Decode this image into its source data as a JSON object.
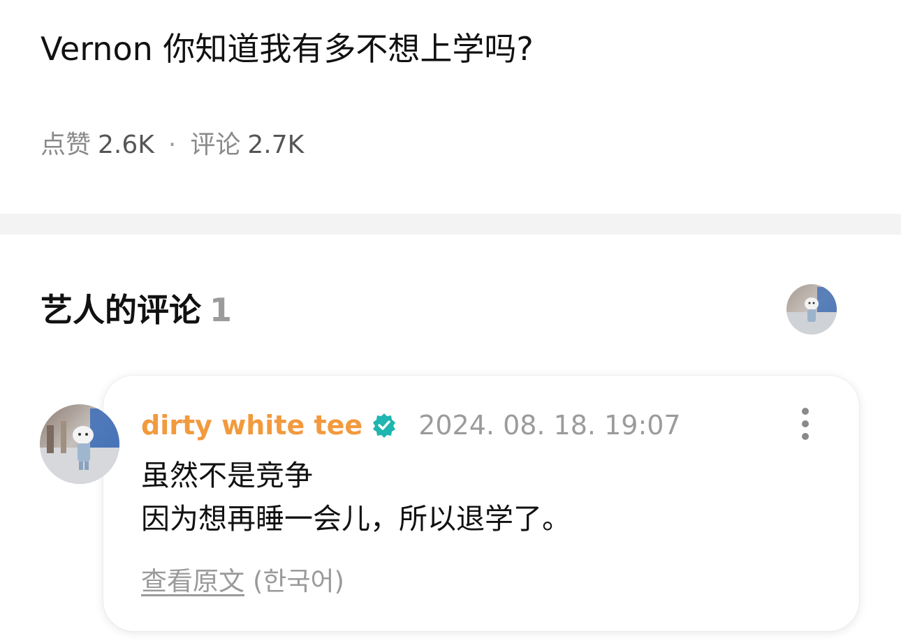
{
  "post": {
    "title": "Vernon 你知道我有多不想上学吗?",
    "likes_label": "点赞",
    "likes_count": "2.6K",
    "separator": "·",
    "comments_label": "评论",
    "comments_count": "2.7K"
  },
  "artist_comments": {
    "header": "艺人的评论",
    "count": "1",
    "items": [
      {
        "author": "dirty white tee",
        "verified_icon": "verified-badge-icon",
        "timestamp": "2024. 08. 18. 19:07",
        "body_line1": "虽然不是竞争",
        "body_line2": "因为想再睡一会儿，所以退学了。",
        "translate_link": "查看原文",
        "original_language": "(한국어)"
      }
    ]
  },
  "colors": {
    "author": "#f29a3e",
    "verified": "#1fb5b0",
    "muted": "#9b9b9b",
    "divider": "#f3f3f3"
  },
  "icons": {
    "more": "more-vertical-icon",
    "avatar": "avatar-image"
  }
}
